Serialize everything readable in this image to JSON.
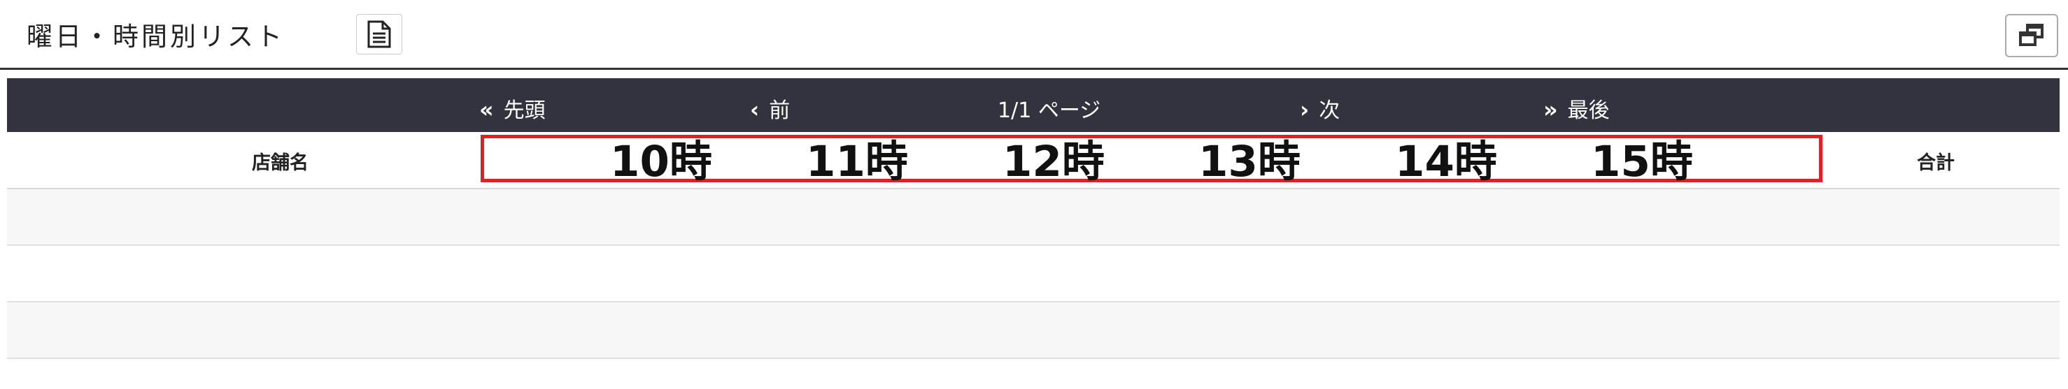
{
  "header": {
    "title": "曜日・時間別リスト",
    "doc_icon": "document-icon",
    "window_icon": "restore-window-icon"
  },
  "pager": {
    "first_label": "先頭",
    "prev_label": "前",
    "page_info": "1/1 ページ",
    "next_label": "次",
    "last_label": "最後"
  },
  "table": {
    "store_header": "店舗名",
    "hours": [
      "10時",
      "11時",
      "12時",
      "13時",
      "14時",
      "15時"
    ],
    "total_header": "合計",
    "rows": [
      {},
      {},
      {}
    ]
  },
  "colors": {
    "pager_bg": "#33333f",
    "highlight_border": "#e31e24",
    "row_alt": "#f7f7f7"
  }
}
